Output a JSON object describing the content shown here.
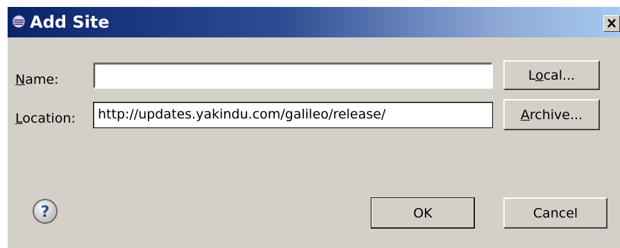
{
  "dialog": {
    "title": "Add Site",
    "name_field": {
      "label_mnemonic": "N",
      "label_rest": "ame:",
      "value": ""
    },
    "location_field": {
      "label_mnemonic": "L",
      "label_rest": "ocation:",
      "value": "http://updates.yakindu.com/galileo/release/"
    },
    "buttons": {
      "local_pre": "L",
      "local_mnemonic": "o",
      "local_rest": "cal...",
      "archive_mnemonic": "A",
      "archive_rest": "rchive...",
      "ok": "OK",
      "cancel": "Cancel"
    },
    "icons": {
      "title_icon": "eclipse-icon",
      "close": "close-icon",
      "help": "help-icon"
    },
    "colors": {
      "titlebar_start": "#0a246a",
      "titlebar_end": "#a6caf0",
      "dialog_bg": "#d4d0c8"
    }
  }
}
